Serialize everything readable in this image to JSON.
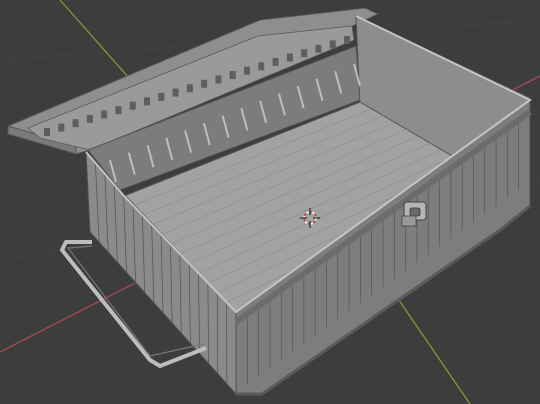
{
  "viewport": {
    "background_color": "#3d3d3d",
    "grid_line_color": "#4a4a4a",
    "x_axis_color": "#b34a5a",
    "y_axis_color": "#7a9a3a"
  },
  "model": {
    "name": "",
    "shade_light": "#9e9e9e",
    "shade_mid": "#858585",
    "shade_dark": "#6a6a6a",
    "wire_color": "#505050",
    "handle_color": "#b8b8b8"
  },
  "cursor_icon": "3d-cursor-icon"
}
